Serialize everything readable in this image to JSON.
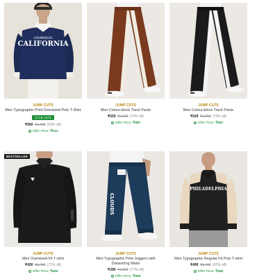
{
  "products": [
    {
      "brand": "JUMP CUTS",
      "title": "Men Typographic Print Oversized Polo T-Shirt",
      "rating": "3.3 ★ | 671",
      "price": "₹560",
      "mrp": "₹1,499",
      "discount": "(63% off)",
      "offer_label": "Offer Price:",
      "offer_price": "₹513"
    },
    {
      "brand": "JUMP CUTS",
      "title": "Men Colour-block Track Pants",
      "price": "₹529",
      "mrp": "₹1,999",
      "discount": "(74% off)",
      "offer_label": "Offer Price:",
      "offer_price": "₹487"
    },
    {
      "brand": "JUMP CUTS",
      "title": "Men Colour-block Track Pants",
      "price": "₹529",
      "mrp": "₹1,999",
      "discount": "(74% off)",
      "offer_label": "Offer Price:",
      "offer_price": "₹487"
    },
    {
      "badge": "BESTSELLER",
      "brand": "JUMP CUTS",
      "title": "Men Oversized Fit T-shirt",
      "price": "₹430",
      "mrp": "₹1,499",
      "discount": "(71% off)",
      "offer_label": "Offer Price:",
      "offer_price": "₹404"
    },
    {
      "brand": "JUMP CUTS",
      "title": "Men Typographic Print Joggers with Drawstring Waist",
      "price": "₹399",
      "mrp": "₹1,999",
      "discount": "(77% off)",
      "offer_label": "Offer Price:",
      "offer_price": "₹359"
    },
    {
      "brand": "JUMP CUTS",
      "title": "Men Typographic Regular Fit Polo T-shirt",
      "price": "₹499",
      "mrp": "₹1,499",
      "discount": "(67% off)",
      "offer_label": "Offer Price:",
      "offer_price": "₹450"
    }
  ],
  "image_texts": {
    "sweatshirt_small": "LOSANGELES",
    "sweatshirt_main": "CALIFORNIA",
    "joggers_print": "CLOUDS",
    "polo_print": "PHILADELPHIA"
  },
  "colors": {
    "brand": "#b8860b",
    "rating_bg": "#1e8f3a",
    "offer": "#1e8f3a"
  }
}
